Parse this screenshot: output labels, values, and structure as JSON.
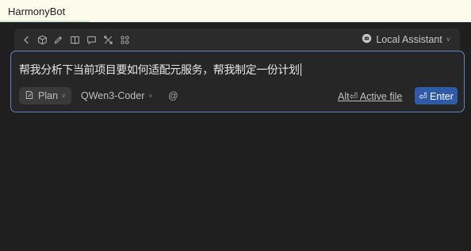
{
  "window": {
    "tab_title": "HarmonyBot"
  },
  "toolbar": {
    "icons": [
      "chevron-left-icon",
      "cube-icon",
      "pencil-icon",
      "book-icon",
      "chat-icon",
      "tools-icon",
      "grid-icon"
    ],
    "assistant_label": "Local Assistant",
    "assistant_chevron": "˅"
  },
  "input": {
    "text": "帮我分析下当前项目要如何适配元服务，帮我制定一份计划"
  },
  "controls": {
    "mode_label": "Plan",
    "model_label": "QWen3-Coder",
    "mention_label": "@",
    "active_file_label": "Alt⏎ Active file",
    "submit_label": "⏎ Enter",
    "chevron": "˅"
  },
  "colors": {
    "background": "#1f1f1f",
    "titlebar": "#fdfbeb",
    "focus_border": "#5b86c9",
    "submit": "#2f5aa8"
  }
}
